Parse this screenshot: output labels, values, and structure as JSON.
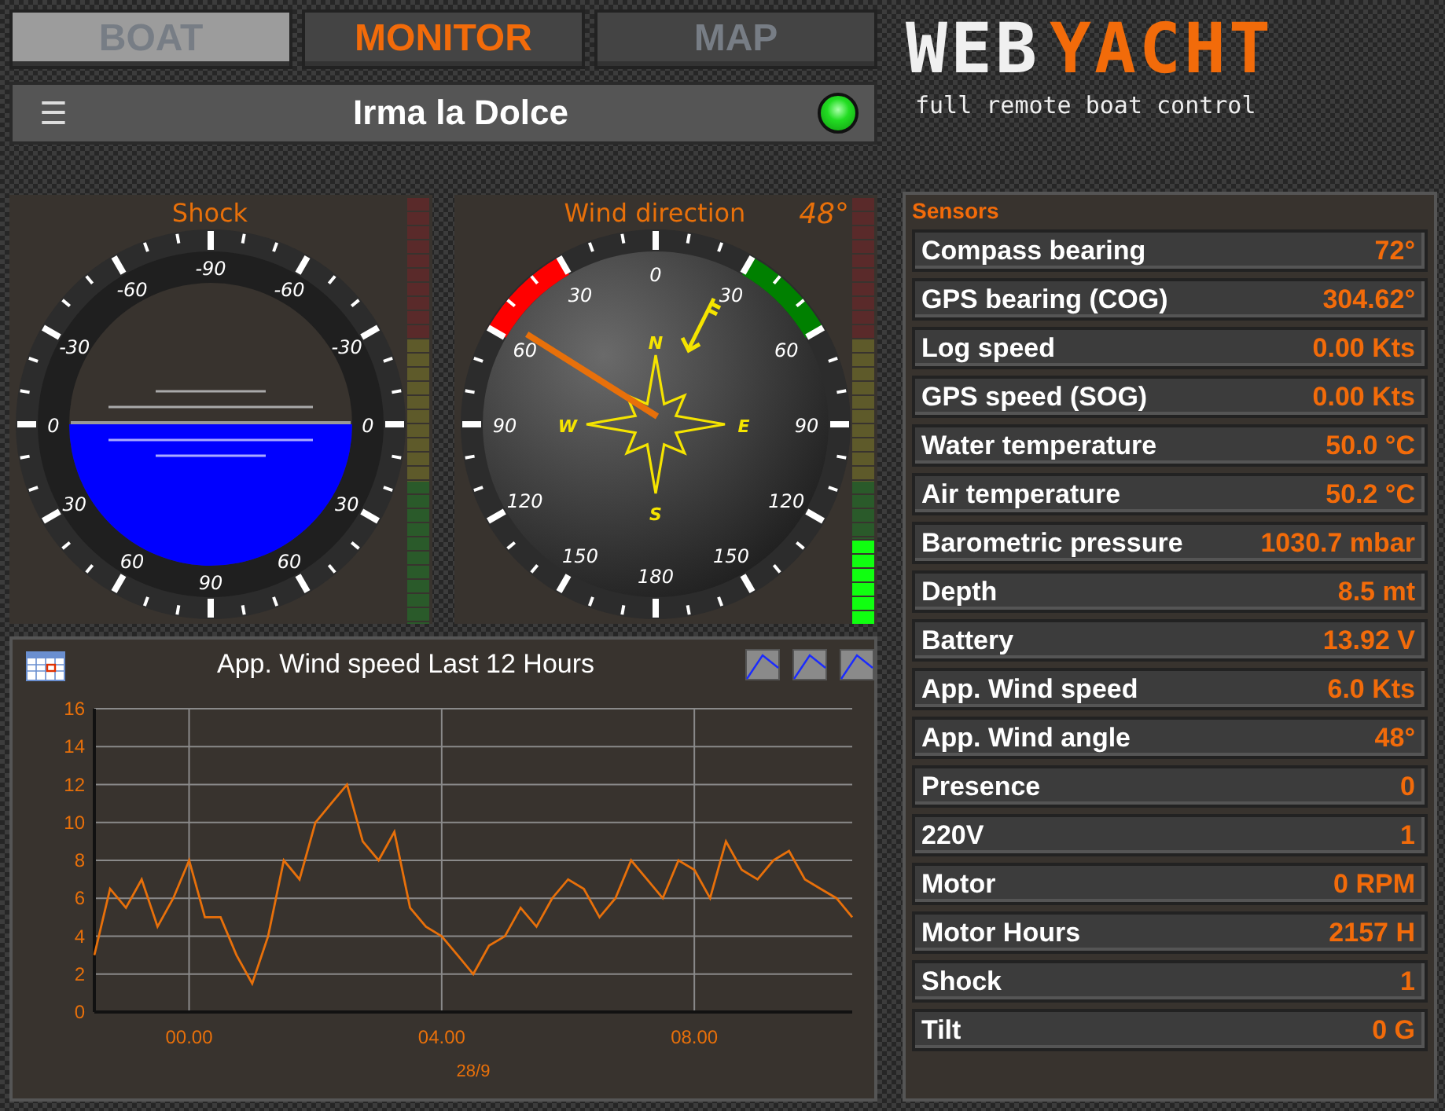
{
  "tabs": [
    {
      "label": "BOAT",
      "selected": false,
      "highlighted": true
    },
    {
      "label": "MONITOR",
      "selected": true,
      "highlighted": false
    },
    {
      "label": "MAP",
      "selected": false,
      "highlighted": false
    }
  ],
  "header": {
    "menu_icon": "☰",
    "boat_name": "Irma la Dolce",
    "status_on": true
  },
  "logo": {
    "part_1": "WEB",
    "part_2": "YACHT",
    "tagline": "full remote boat control"
  },
  "gauges": [
    {
      "kind": "horizon",
      "title": "Shock",
      "scale": [
        "-90",
        "-60",
        "-30",
        "0",
        "30",
        "60",
        "90",
        "60",
        "30",
        "0",
        "-30",
        "-60"
      ]
    },
    {
      "kind": "compass",
      "title": "Wind direction",
      "reading": "48°",
      "scale": [
        "0",
        "30",
        "60",
        "90",
        "120",
        "150",
        "180",
        "150",
        "120",
        "90",
        "60",
        "30"
      ],
      "compass_letters": [
        "N",
        "E",
        "S",
        "W"
      ],
      "meter": {
        "level": 0.2
      }
    }
  ],
  "chart_panel": {
    "title": "App. Wind speed Last 12 Hours",
    "chart_data": {
      "type": "line",
      "grid": true,
      "xlabel": "28/9",
      "xlim": [
        -1.5,
        10.5
      ],
      "ylim": [
        0,
        16
      ],
      "xticks": [
        {
          "value": 0,
          "label": "00.00"
        },
        {
          "value": 4,
          "label": "04.00"
        },
        {
          "value": 8,
          "label": "08.00"
        }
      ],
      "yticks": [
        0,
        2,
        4,
        6,
        8,
        10,
        12,
        14,
        16
      ],
      "x": [
        -1.5,
        -1.25,
        -1,
        -0.75,
        -0.5,
        -0.25,
        0,
        0.25,
        0.5,
        0.75,
        1,
        1.25,
        1.5,
        1.75,
        2,
        2.25,
        2.5,
        2.75,
        3,
        3.25,
        3.5,
        3.75,
        4,
        4.25,
        4.5,
        4.75,
        5,
        5.25,
        5.5,
        5.75,
        6,
        6.25,
        6.5,
        6.75,
        7,
        7.25,
        7.5,
        7.75,
        8,
        8.25,
        8.5,
        8.75,
        9,
        9.25,
        9.5,
        9.75,
        10,
        10.25,
        10.5
      ],
      "series": [
        {
          "color": "#e8700a",
          "values": [
            3,
            6.5,
            5.5,
            7,
            4.5,
            6,
            8,
            5,
            5,
            3,
            1.5,
            4,
            8,
            7,
            10,
            11,
            12,
            9,
            8,
            9.5,
            5.5,
            4.5,
            4,
            3,
            2,
            3.5,
            4,
            5.5,
            4.5,
            6,
            7,
            6.5,
            5,
            6,
            8,
            7,
            6,
            8,
            7.5,
            6,
            9,
            7.5,
            7,
            8,
            8.5,
            7,
            6.5,
            6,
            5
          ]
        }
      ]
    }
  },
  "sensors": {
    "title": "Sensors",
    "rows": [
      {
        "label": "Compass bearing",
        "value": "72°"
      },
      {
        "label": "GPS bearing (COG)",
        "value": "304.62°"
      },
      {
        "label": "Log speed",
        "value": "0.00 Kts"
      },
      {
        "label": "GPS speed (SOG)",
        "value": "0.00 Kts"
      },
      {
        "label": "Water temperature",
        "value": "50.0 °C"
      },
      {
        "label": "Air temperature",
        "value": "50.2 °C"
      },
      {
        "label": "Barometric pressure",
        "value": "1030.7 mbar"
      },
      {
        "label": "Depth",
        "value": "8.5 mt"
      },
      {
        "label": "Battery",
        "value": "13.92 V"
      },
      {
        "label": "App. Wind speed",
        "value": "6.0 Kts"
      },
      {
        "label": "App. Wind angle",
        "value": "48°"
      },
      {
        "label": "Presence",
        "value": "0"
      },
      {
        "label": "220V",
        "value": "1"
      },
      {
        "label": "Motor",
        "value": "0 RPM"
      },
      {
        "label": "Motor Hours",
        "value": "2157 H"
      },
      {
        "label": "Shock",
        "value": "1"
      },
      {
        "label": "Tilt",
        "value": "0 G"
      }
    ]
  }
}
